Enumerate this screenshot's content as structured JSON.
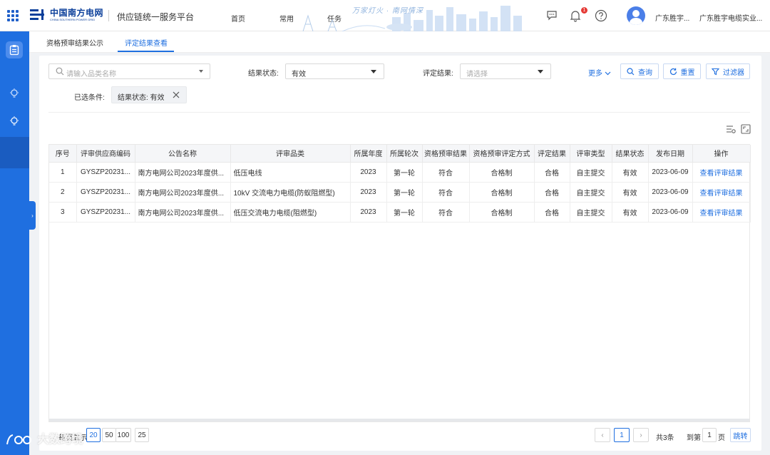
{
  "header": {
    "logo_cn": "中国南方电网",
    "logo_en": "CHINA SOUTHERN POWER GRID",
    "platform_name": "供应链统一服务平台",
    "nav": [
      {
        "label": "首页"
      },
      {
        "label": "常用"
      },
      {
        "label": "任务"
      }
    ],
    "slogan": "万家灯火 · 南网情深",
    "notification_count": "1",
    "user_name": "广东胜宇...",
    "company_name": "广东胜宇电缆实业..."
  },
  "tabs": [
    {
      "label": "资格预审结果公示",
      "active": false
    },
    {
      "label": "评定结果查看",
      "active": true
    }
  ],
  "filters": {
    "search_placeholder": "请输入品类名称",
    "status_label": "结果状态:",
    "status_value": "有效",
    "result_label": "评定结果:",
    "result_placeholder": "请选择",
    "more_label": "更多",
    "query_label": "查询",
    "reset_label": "重置",
    "filter_label": "过滤器"
  },
  "selected_conditions": {
    "label": "已选条件:",
    "chip": "结果状态: 有效"
  },
  "table": {
    "columns": [
      "序号",
      "评审供应商编码",
      "公告名称",
      "评审品类",
      "所属年度",
      "所属轮次",
      "资格预审结果",
      "资格预审评定方式",
      "评定结果",
      "评审类型",
      "结果状态",
      "发布日期",
      "操作"
    ],
    "rows": [
      {
        "no": "1",
        "code": "GYSZP20231...",
        "notice": "南方电网公司2023年度供...",
        "category": "低压电线",
        "year": "2023",
        "round": "第一轮",
        "prequal": "符合",
        "method": "合格制",
        "result": "合格",
        "type": "自主提交",
        "status": "有效",
        "date": "2023-06-09",
        "action": "查看评审结果"
      },
      {
        "no": "2",
        "code": "GYSZP20231...",
        "notice": "南方电网公司2023年度供...",
        "category": "10kV 交流电力电缆(防蚁阻燃型)",
        "year": "2023",
        "round": "第一轮",
        "prequal": "符合",
        "method": "合格制",
        "result": "合格",
        "type": "自主提交",
        "status": "有效",
        "date": "2023-06-09",
        "action": "查看评审结果"
      },
      {
        "no": "3",
        "code": "GYSZP20231...",
        "notice": "南方电网公司2023年度供...",
        "category": "低压交流电力电缆(阻燃型)",
        "year": "2023",
        "round": "第一轮",
        "prequal": "符合",
        "method": "合格制",
        "result": "合格",
        "type": "自主提交",
        "status": "有效",
        "date": "2023-06-09",
        "action": "查看评审结果"
      }
    ]
  },
  "pagination": {
    "page_size_label": "每页显示:",
    "page_sizes": [
      "20",
      "50",
      "100",
      "25"
    ],
    "current_page": "1",
    "total_text": "共3条",
    "goto_label": "到第",
    "goto_value": "1",
    "page_unit": "页",
    "jump_label": "跳转"
  },
  "watermark": "大数跨境",
  "colors": {
    "brand": "#1f6fe0",
    "sidebar": "#1f6fe0",
    "logo": "#0b3f9a"
  }
}
